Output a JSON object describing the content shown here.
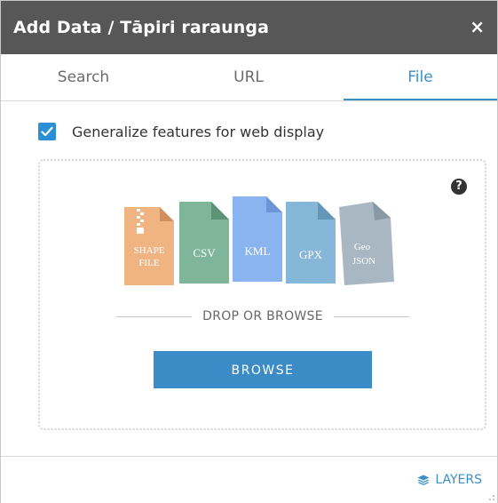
{
  "window": {
    "title": "Add Data / Tāpiri raraunga",
    "close_label": "×"
  },
  "tabs": [
    {
      "label": "Search",
      "active": false
    },
    {
      "label": "URL",
      "active": false
    },
    {
      "label": "File",
      "active": true
    }
  ],
  "options": {
    "generalize_label": "Generalize features for web display",
    "generalize_checked": true
  },
  "dropzone": {
    "help_label": "?",
    "file_types": [
      {
        "line1": "SHAPE",
        "line2": "FILE",
        "color": "#f0b483",
        "icon": "zip-icon"
      },
      {
        "line1": "CSV",
        "line2": "",
        "color": "#7fb69a"
      },
      {
        "line1": "KML",
        "line2": "",
        "color": "#8ab4f0"
      },
      {
        "line1": "GPX",
        "line2": "",
        "color": "#86b6d8"
      },
      {
        "line1": "Geo",
        "line2": "JSON",
        "color": "#a8b7c2"
      }
    ],
    "drop_text": "DROP OR BROWSE",
    "browse_label": "BROWSE"
  },
  "footer": {
    "layers_label": "LAYERS",
    "layers_icon": "layers-icon"
  },
  "colors": {
    "titlebar": "#575757",
    "accent": "#3a8fc7",
    "button": "#3b8bc7"
  }
}
